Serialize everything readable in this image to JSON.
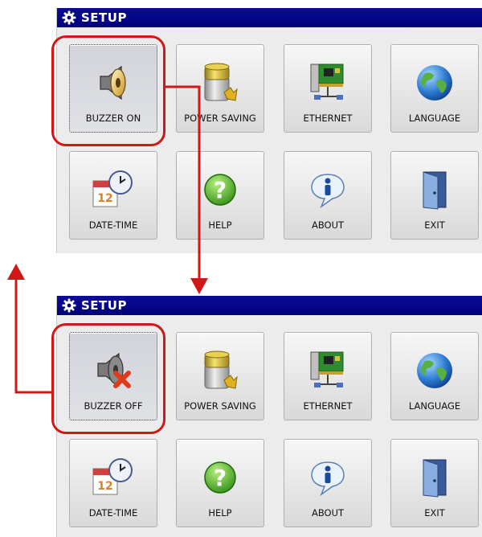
{
  "screens": [
    {
      "title": "SETUP",
      "buttons": [
        {
          "label": "BUZZER ON",
          "icon": "speaker-icon"
        },
        {
          "label": "POWER SAVING",
          "icon": "battery-icon"
        },
        {
          "label": "ETHERNET",
          "icon": "network-card-icon"
        },
        {
          "label": "LANGUAGE",
          "icon": "globe-icon"
        },
        {
          "label": "DATE-TIME",
          "icon": "calendar-clock-icon"
        },
        {
          "label": "HELP",
          "icon": "help-icon"
        },
        {
          "label": "ABOUT",
          "icon": "info-icon"
        },
        {
          "label": "EXIT",
          "icon": "door-icon"
        }
      ]
    },
    {
      "title": "SETUP",
      "buttons": [
        {
          "label": "BUZZER OFF",
          "icon": "speaker-muted-icon"
        },
        {
          "label": "POWER SAVING",
          "icon": "battery-icon"
        },
        {
          "label": "ETHERNET",
          "icon": "network-card-icon"
        },
        {
          "label": "LANGUAGE",
          "icon": "globe-icon"
        },
        {
          "label": "DATE-TIME",
          "icon": "calendar-clock-icon"
        },
        {
          "label": "HELP",
          "icon": "help-icon"
        },
        {
          "label": "ABOUT",
          "icon": "info-icon"
        },
        {
          "label": "EXIT",
          "icon": "door-icon"
        }
      ]
    }
  ],
  "colors": {
    "titlebar": "#000078",
    "highlight": "#d01818",
    "panel": "#ececec"
  }
}
